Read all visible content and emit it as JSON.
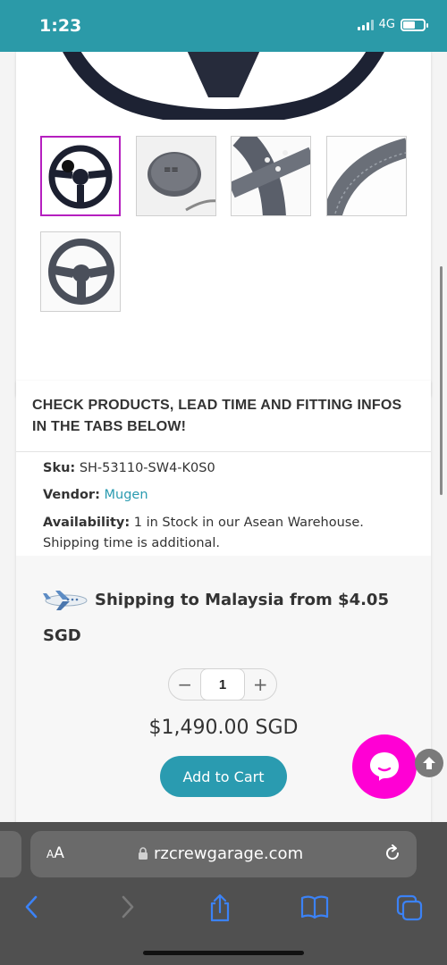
{
  "status_bar": {
    "time": "1:23",
    "network": "4G",
    "battery_level": 0.6
  },
  "product": {
    "header_notice": "CHECK PRODUCTS, LEAD TIME AND FITTING INFOS IN THE TABS BELOW!",
    "sku_label": "Sku:",
    "sku": "SH-53110-SW4-K0S0",
    "vendor_label": "Vendor:",
    "vendor": "Mugen",
    "availability_label": "Availability:",
    "availability": "1 in Stock in our Asean Warehouse. Shipping time is additional.",
    "shipping_text": "Shipping to Malaysia from $4.05 SGD",
    "quantity": "1",
    "qty_minus": "−",
    "qty_plus": "+",
    "price": "$1,490.00 SGD",
    "add_to_cart": "Add to Cart"
  },
  "browser": {
    "text_size_small": "A",
    "text_size_large": "A",
    "url": "rzcrewgarage.com"
  },
  "colors": {
    "accent": "#2a9bb0",
    "status_bar": "#2b9aa8",
    "chat": "#ff00d4",
    "active_thumb": "#b51fbf"
  },
  "icons": [
    "airplane-icon",
    "chat-icon",
    "arrow-up-icon",
    "lock-icon",
    "reload-icon",
    "back-icon",
    "forward-icon",
    "share-icon",
    "bookmarks-icon",
    "tabs-icon"
  ]
}
